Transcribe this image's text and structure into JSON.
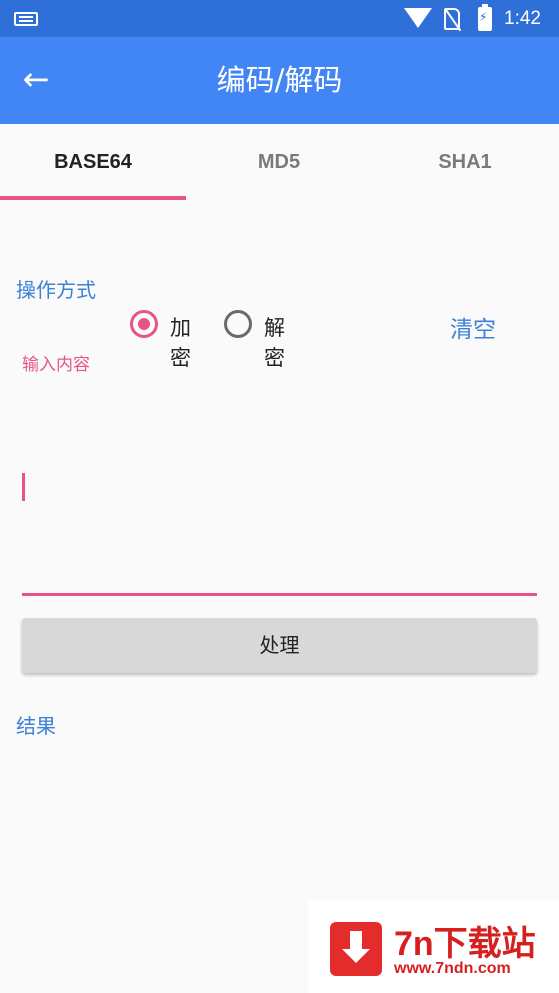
{
  "status_bar": {
    "time": "1:42"
  },
  "app_bar": {
    "title": "编码/解码",
    "back_icon": "arrow-left-icon"
  },
  "tabs": [
    {
      "label": "BASE64",
      "active": true
    },
    {
      "label": "MD5",
      "active": false
    },
    {
      "label": "SHA1",
      "active": false
    }
  ],
  "operation": {
    "label": "操作方式",
    "options": [
      {
        "label": "加密",
        "checked": true
      },
      {
        "label": "解密",
        "checked": false
      }
    ],
    "clear_label": "清空"
  },
  "input": {
    "hint_label": "输入内容",
    "value": ""
  },
  "process_button": {
    "label": "处理"
  },
  "result": {
    "label": "结果"
  },
  "watermark": {
    "title": "7n下载站",
    "url": "www.7ndn.com"
  },
  "colors": {
    "app_bar": "#4285f4",
    "status_bar": "#2f6fd8",
    "accent": "#e85585",
    "link_blue": "#3b82d6"
  }
}
